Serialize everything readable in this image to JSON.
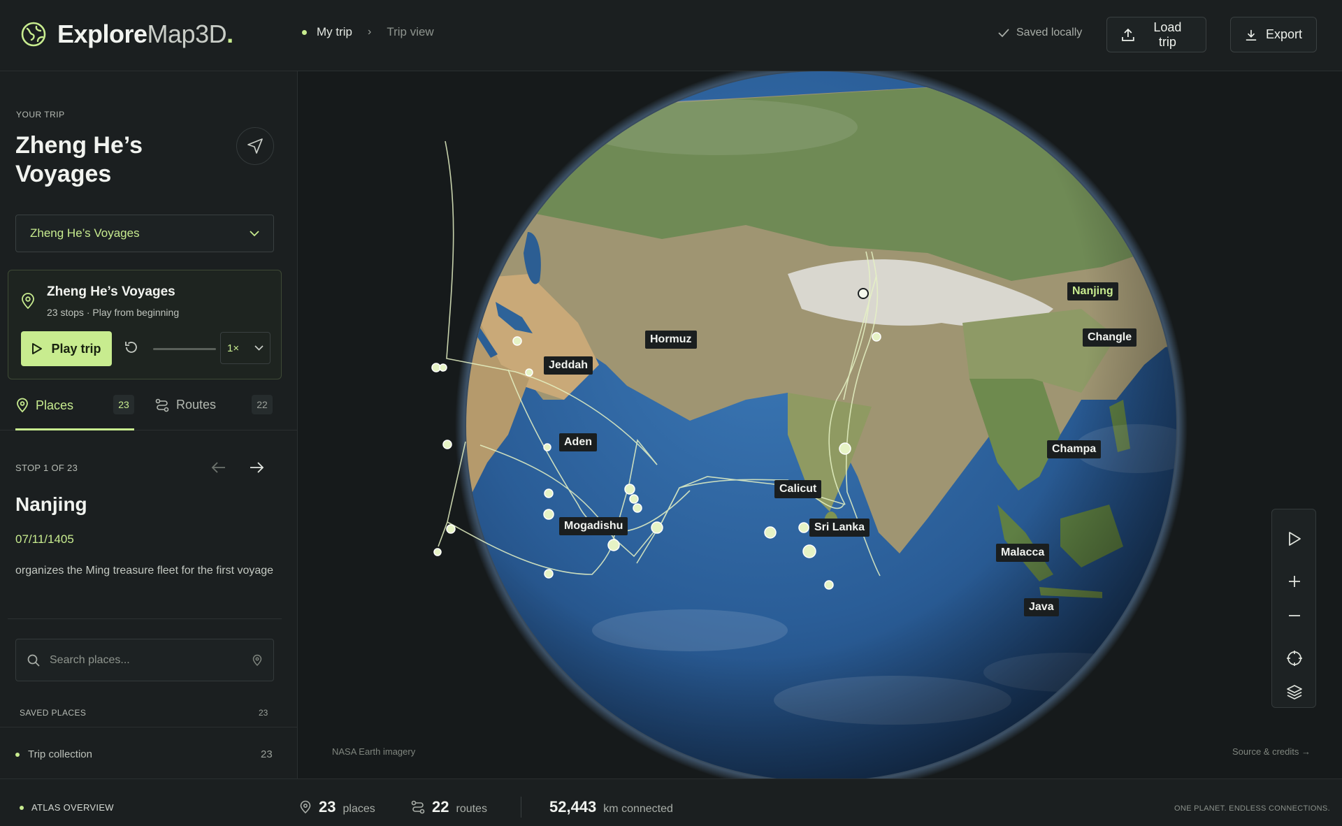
{
  "app": {
    "logo_bold": "Explore",
    "logo_light": "Map3D",
    "logo_dot": "."
  },
  "breadcrumb": {
    "items": [
      "My trip",
      "Trip view"
    ]
  },
  "header": {
    "saved_status": "Saved locally",
    "load_label": "Load trip",
    "export_label": "Export"
  },
  "sidebar": {
    "eyebrow": "YOUR TRIP",
    "trip_title": "Zheng He’s Voyages",
    "trip_select_value": "Zheng He’s Voyages",
    "player": {
      "title": "Zheng He’s Voyages",
      "subtitle": "23 stops · Play from beginning",
      "play_label": "Play trip",
      "speed": "1×",
      "progress": 0
    },
    "tabs": [
      {
        "label": "Places",
        "count": "23",
        "icon": "pin-icon"
      },
      {
        "label": "Routes",
        "count": "22",
        "icon": "route-icon"
      }
    ],
    "stop": {
      "counter": "STOP 1 OF 23",
      "name": "Nanjing",
      "date": "07/11/1405",
      "description": "organizes the Ming treasure fleet for the first voyage"
    },
    "search_placeholder": "Search places...",
    "saved_places_label": "SAVED PLACES",
    "saved_places_count": "23",
    "collection": {
      "label": "Trip collection",
      "count": "23"
    }
  },
  "map": {
    "labels": [
      "Nanjing",
      "Changle",
      "Hormuz",
      "Jeddah",
      "Aden",
      "Champa",
      "Calicut",
      "Sri Lanka",
      "Mogadishu",
      "Malacca",
      "Java"
    ],
    "attribution_left": "NASA Earth imagery",
    "attribution_right": "Source & credits →"
  },
  "footer": {
    "atlas_label": "ATLAS OVERVIEW",
    "places_num": "23",
    "places_unit": "places",
    "routes_num": "22",
    "routes_unit": "routes",
    "km_num": "52,443",
    "km_unit": "km connected",
    "tagline": "ONE PLANET. ENDLESS CONNECTIONS."
  },
  "colors": {
    "accent": "#c8ec8f",
    "background": "#161a1b",
    "panel": "#1b1f20",
    "ocean": "#2b5c94",
    "land": "#b8a37f"
  }
}
